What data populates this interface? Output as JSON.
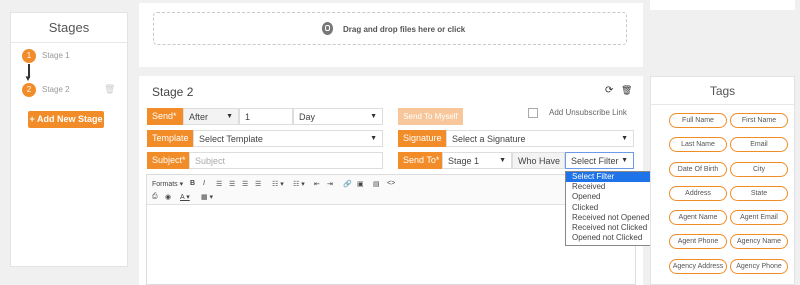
{
  "stages_panel": {
    "title": "Stages",
    "stages": [
      {
        "number": "1",
        "name": "Stage 1"
      },
      {
        "number": "2",
        "name": "Stage 2"
      }
    ],
    "add_button": "+ Add New Stage"
  },
  "dropzone": {
    "text": "Drag and drop files here or click"
  },
  "stage_form": {
    "title": "Stage 2",
    "send_label": "Send*",
    "send_timing": "After",
    "send_amount": "1",
    "send_unit": "Day",
    "send_to_myself": "Send To Myself",
    "add_unsubscribe": "Add Unsubscribe Link",
    "template_label": "Template",
    "template_value": "Select Template",
    "signature_label": "Signature",
    "signature_value": "Select a Signature",
    "subject_label": "Subject*",
    "subject_placeholder": "Subject",
    "send_to_label": "Send To*",
    "send_to_stage": "Stage 1",
    "who_have": "Who Have",
    "filter_value": "Select Filter"
  },
  "editor": {
    "formats_label": "Formats"
  },
  "filter_options": [
    "Select Filter",
    "Received",
    "Opened",
    "Clicked",
    "Received not Opened",
    "Received not Clicked",
    "Opened not Clicked"
  ],
  "tags_panel": {
    "title": "Tags",
    "tags": [
      "Full Name",
      "First Name",
      "Last Name",
      "Email",
      "Date Of Birth",
      "City",
      "Address",
      "State",
      "Agent Name",
      "Agent Email",
      "Agent Phone",
      "Agency Name",
      "Agency Address",
      "Agency Phone"
    ]
  },
  "colors": {
    "accent": "#f28c28",
    "accent_muted": "#f7c79b",
    "selected": "#1e73e8"
  }
}
